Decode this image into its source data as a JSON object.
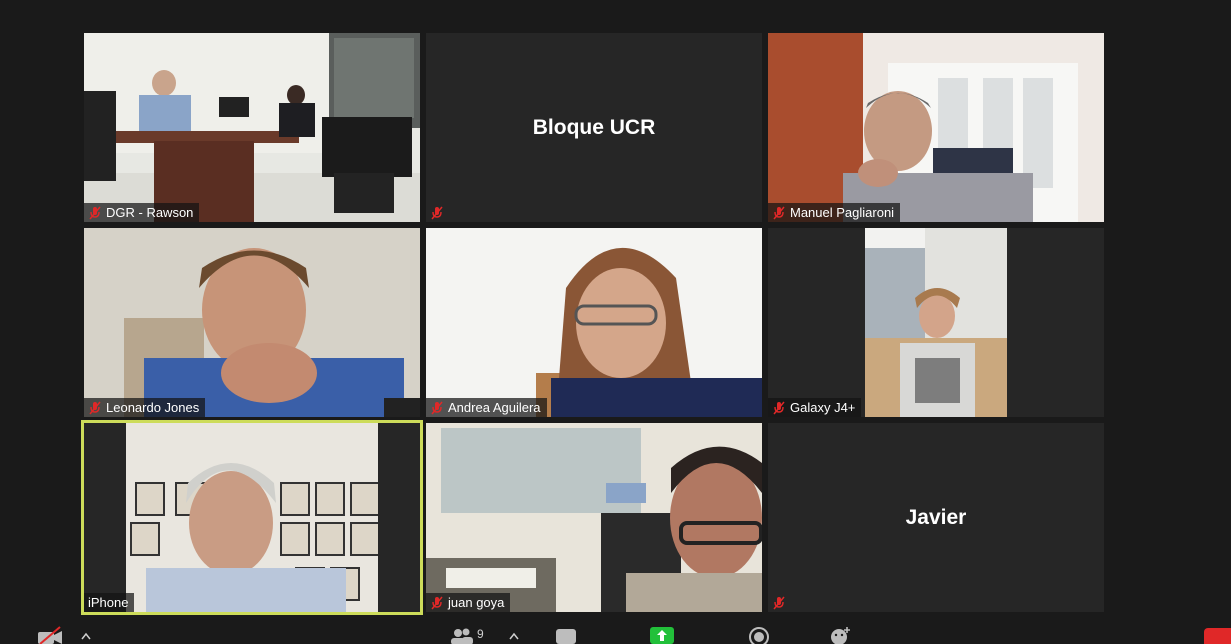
{
  "tiles": [
    {
      "name": "DGR - Rawson",
      "muted": true,
      "kind": "video"
    },
    {
      "name": "Bloque UCR",
      "muted": true,
      "kind": "name"
    },
    {
      "name": "Manuel Pagliaroni",
      "muted": true,
      "kind": "video"
    },
    {
      "name": "Leonardo Jones",
      "muted": true,
      "kind": "video"
    },
    {
      "name": "Andrea Aguilera",
      "muted": true,
      "kind": "video"
    },
    {
      "name": "Galaxy J4+",
      "muted": true,
      "kind": "video"
    },
    {
      "name": "iPhone",
      "muted": false,
      "kind": "video",
      "active_speaker": true
    },
    {
      "name": "juan goya",
      "muted": true,
      "kind": "video"
    },
    {
      "name": "Javier",
      "muted": true,
      "kind": "name"
    }
  ],
  "toolbar": {
    "participants_count": "9"
  },
  "colors": {
    "background": "#1a1a1a",
    "tile": "#262626",
    "active_border": "#cddc5a",
    "muted_icon": "#e02828",
    "share_button": "#22c03a"
  }
}
